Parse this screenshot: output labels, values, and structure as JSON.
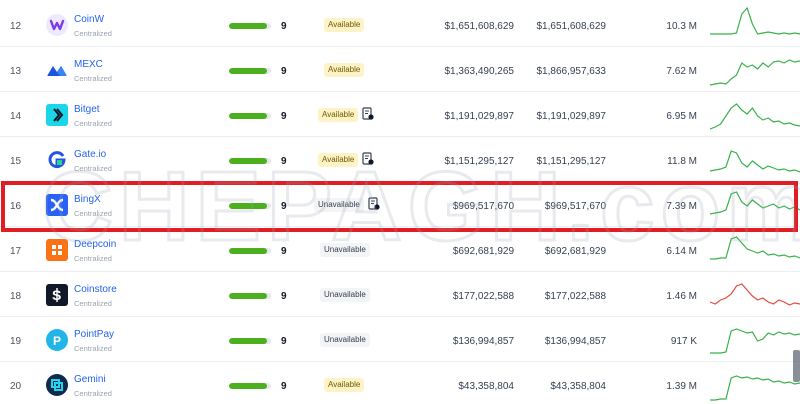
{
  "colors": {
    "up": "#38b24a",
    "down": "#e24a3b",
    "score_bar": "#4caf1e",
    "highlight": "#e11d23",
    "link": "#2563eb"
  },
  "watermark": "CHEPAGH.com",
  "rows": [
    {
      "rank": "12",
      "name": "CoinW",
      "type": "Centralized",
      "score": "9",
      "score_fraction": 0.9,
      "status": "Available",
      "status_kind": "available",
      "doc_icon": false,
      "col1": "$1,651,608,629",
      "col2": "$1,651,608,629",
      "volume": "10.3 M",
      "trend": "up",
      "logo_icon": "coinw-icon",
      "logo_bg": "#ede9fe",
      "logo_fg": "#7c3aed",
      "spark": [
        30,
        30,
        30,
        30,
        30,
        29,
        10,
        4,
        20,
        30,
        29,
        28,
        29,
        30,
        29,
        30,
        29,
        30
      ]
    },
    {
      "rank": "13",
      "name": "MEXC",
      "type": "Centralized",
      "score": "9",
      "score_fraction": 0.9,
      "status": "Available",
      "status_kind": "available",
      "doc_icon": false,
      "col1": "$1,363,490,265",
      "col2": "$1,866,957,633",
      "volume": "7.62 M",
      "trend": "up",
      "logo_icon": "mexc-icon",
      "logo_bg": "#ffffff",
      "logo_fg": "#1a56db",
      "spark": [
        36,
        35,
        34,
        35,
        30,
        26,
        14,
        18,
        16,
        20,
        14,
        18,
        13,
        12,
        14,
        11,
        13,
        12
      ]
    },
    {
      "rank": "14",
      "name": "Bitget",
      "type": "Centralized",
      "score": "9",
      "score_fraction": 0.9,
      "status": "Available",
      "status_kind": "available",
      "doc_icon": true,
      "col1": "$1,191,029,897",
      "col2": "$1,191,029,897",
      "volume": "6.95 M",
      "trend": "up",
      "logo_icon": "bitget-icon",
      "logo_bg": "#1bd6e7",
      "logo_fg": "#0f172a",
      "spark": [
        35,
        33,
        30,
        22,
        14,
        10,
        16,
        20,
        14,
        22,
        26,
        24,
        28,
        27,
        30,
        29,
        31,
        32
      ]
    },
    {
      "rank": "15",
      "name": "Gate.io",
      "type": "Centralized",
      "score": "9",
      "score_fraction": 0.9,
      "status": "Available",
      "status_kind": "available",
      "doc_icon": true,
      "col1": "$1,151,295,127",
      "col2": "$1,151,295,127",
      "volume": "11.8 M",
      "trend": "up",
      "logo_icon": "gateio-icon",
      "logo_bg": "#ffffff",
      "logo_fg": "#2354e6",
      "spark": [
        32,
        31,
        30,
        28,
        12,
        14,
        24,
        28,
        22,
        26,
        30,
        27,
        29,
        31,
        30,
        32,
        31,
        33
      ]
    },
    {
      "rank": "16",
      "name": "BingX",
      "type": "Centralized",
      "score": "9",
      "score_fraction": 0.9,
      "status": "Unavailable",
      "status_kind": "unavailable",
      "doc_icon": true,
      "col1": "$969,517,670",
      "col2": "$969,517,670",
      "volume": "7.39 M",
      "trend": "up",
      "logo_icon": "bingx-icon",
      "logo_bg": "#2a62f5",
      "logo_fg": "#ffffff",
      "spark": [
        30,
        29,
        28,
        26,
        10,
        8,
        18,
        22,
        16,
        20,
        24,
        22,
        20,
        24,
        22,
        25,
        23,
        26
      ]
    },
    {
      "rank": "17",
      "name": "Deepcoin",
      "type": "Centralized",
      "score": "9",
      "score_fraction": 0.9,
      "status": "Unavailable",
      "status_kind": "unavailable",
      "doc_icon": false,
      "col1": "$692,681,929",
      "col2": "$692,681,929",
      "volume": "6.14 M",
      "trend": "up",
      "logo_icon": "deepcoin-icon",
      "logo_bg": "#f97316",
      "logo_fg": "#ffffff",
      "spark": [
        30,
        30,
        29,
        29,
        10,
        8,
        14,
        20,
        22,
        24,
        22,
        26,
        25,
        27,
        26,
        28,
        27,
        29
      ]
    },
    {
      "rank": "18",
      "name": "Coinstore",
      "type": "Centralized",
      "score": "9",
      "score_fraction": 0.9,
      "status": "Unavailable",
      "status_kind": "unavailable",
      "doc_icon": false,
      "col1": "$177,022,588",
      "col2": "$177,022,588",
      "volume": "1.46 M",
      "trend": "down",
      "logo_icon": "coinstore-icon",
      "logo_bg": "#111827",
      "logo_fg": "#ffffff",
      "spark": [
        28,
        30,
        26,
        24,
        20,
        12,
        10,
        16,
        22,
        26,
        24,
        28,
        30,
        26,
        28,
        31,
        29,
        30
      ]
    },
    {
      "rank": "19",
      "name": "PointPay",
      "type": "Centralized",
      "score": "9",
      "score_fraction": 0.9,
      "status": "Unavailable",
      "status_kind": "unavailable",
      "doc_icon": false,
      "col1": "$136,994,857",
      "col2": "$136,994,857",
      "volume": "917 K",
      "trend": "up",
      "logo_icon": "pointpay-icon",
      "logo_bg": "#22b6e8",
      "logo_fg": "#ffffff",
      "spark": [
        34,
        34,
        34,
        33,
        12,
        10,
        12,
        14,
        13,
        22,
        20,
        14,
        16,
        13,
        15,
        14,
        16,
        15
      ]
    },
    {
      "rank": "20",
      "name": "Gemini",
      "type": "Centralized",
      "score": "9",
      "score_fraction": 0.9,
      "status": "Available",
      "status_kind": "available",
      "doc_icon": false,
      "col1": "$43,358,804",
      "col2": "$43,358,804",
      "volume": "1.39 M",
      "trend": "up",
      "logo_icon": "gemini-icon",
      "logo_bg": "#0f2a4a",
      "logo_fg": "#22d3ee",
      "spark": [
        36,
        36,
        35,
        35,
        14,
        12,
        14,
        13,
        15,
        14,
        16,
        15,
        18,
        17,
        19,
        18,
        20,
        19
      ]
    }
  ]
}
